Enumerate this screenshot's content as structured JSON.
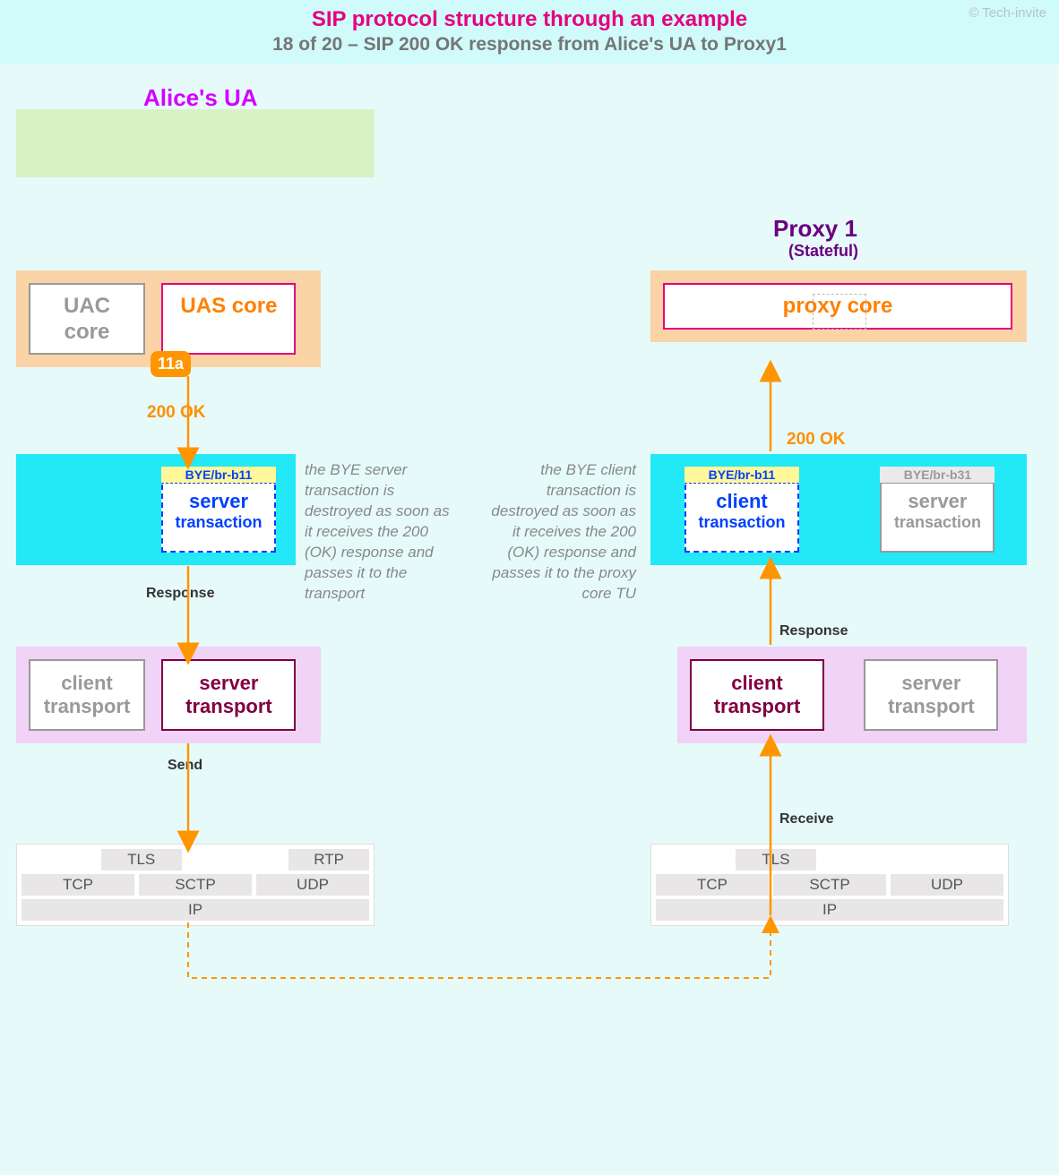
{
  "header": {
    "title": "SIP protocol structure through an example",
    "subtitle": "18 of 20 – SIP 200 OK response from Alice's UA to Proxy1",
    "copyright": "© Tech-invite"
  },
  "alice": {
    "title": "Alice's UA"
  },
  "proxy": {
    "title": "Proxy 1",
    "subtitle": "(Stateful)"
  },
  "cores": {
    "uac": "UAC core",
    "uas": "UAS core",
    "proxy": "proxy core"
  },
  "badge": "11a",
  "messages": {
    "ok1": "200 OK",
    "ok2": "200 OK"
  },
  "labels": {
    "response1": "Response",
    "response2": "Response",
    "send": "Send",
    "receive": "Receive"
  },
  "trans": {
    "alice_tag": "BYE/br-b11",
    "alice_type": "server",
    "alice_sub": "transaction",
    "p1c_tag": "BYE/br-b11",
    "p1c_type": "client",
    "p1c_sub": "transaction",
    "p1s_tag": "BYE/br-b31",
    "p1s_type": "server",
    "p1s_sub": "transaction"
  },
  "tsp": {
    "client": "client transport",
    "server": "server transport"
  },
  "notes": {
    "left": "the BYE server transaction is destroyed as soon as it receives the 200 (OK) response and passes it to the transport",
    "right": "the BYE client transaction is destroyed as soon as it receives the 200 (OK) response and passes it to the proxy core TU"
  },
  "stack": {
    "tls": "TLS",
    "rtp": "RTP",
    "tcp": "TCP",
    "sctp": "SCTP",
    "udp": "UDP",
    "ip": "IP"
  }
}
